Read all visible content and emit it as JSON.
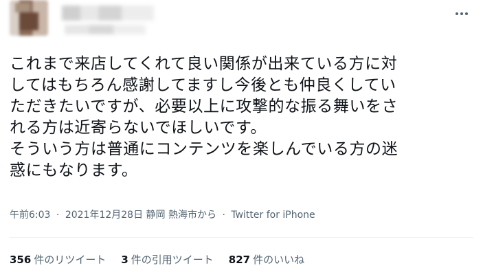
{
  "tweet": {
    "text_lines": [
      "これまで来店してくれて良い関係が出来ている方に対",
      "してはもちろん感謝してますし今後とも仲良くしてい",
      "ただきたいですが、必要以上に攻撃的な振る舞いをさ",
      "れる方は近寄らないでほしいです。",
      "そういう方は普通にコンテンツを楽しんでいる方の迷",
      "惑にもなります。"
    ],
    "time": "午前6:03",
    "separator": "·",
    "date": "2021年12月28日",
    "location": "静岡 熱海市から",
    "source": "Twitter for iPhone"
  },
  "stats": {
    "retweets_count": "356",
    "retweets_label": "件のリツイート",
    "quotes_count": "3",
    "quotes_label": "件の引用ツイート",
    "likes_count": "827",
    "likes_label": "件のいいね"
  },
  "icons": {
    "more": "more-horizontal-icon"
  },
  "colors": {
    "text": "#0f1419",
    "secondary": "#536471",
    "divider": "#eff3f4"
  }
}
